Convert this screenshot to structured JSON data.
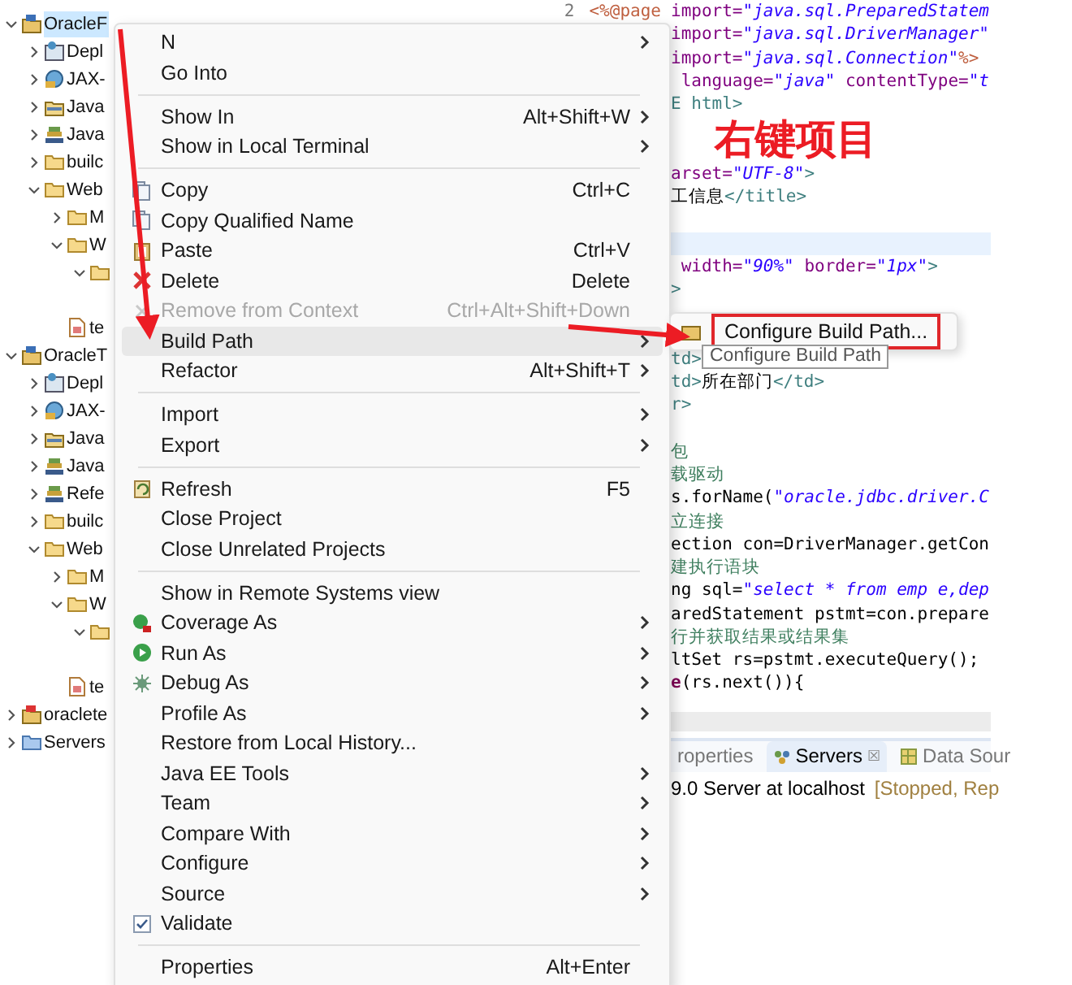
{
  "annotation": {
    "text": "右键项目"
  },
  "tree": [
    {
      "label": "OracleF",
      "kind": "project",
      "selected": true,
      "expanded": true,
      "children": [
        {
          "label": "Depl",
          "kind": "descriptor",
          "selected": false,
          "expanded": false
        },
        {
          "label": "JAX-",
          "kind": "service",
          "selected": false,
          "expanded": false
        },
        {
          "label": "Java",
          "kind": "library",
          "selected": false,
          "expanded": false
        },
        {
          "label": "Java",
          "kind": "script",
          "selected": false,
          "expanded": false
        },
        {
          "label": "builc",
          "kind": "folder",
          "selected": false,
          "expanded": false
        },
        {
          "label": "Web",
          "kind": "folder",
          "selected": false,
          "expanded": true,
          "children": [
            {
              "label": "M",
              "kind": "folder",
              "selected": false,
              "expanded": false
            },
            {
              "label": "W",
              "kind": "folder",
              "selected": false,
              "expanded": true,
              "children": [
                {
                  "kind": "folder",
                  "expanded": true
                }
              ]
            },
            {
              "label": "te",
              "kind": "file",
              "selected": false
            }
          ]
        }
      ]
    },
    {
      "label": "OracleT",
      "kind": "project",
      "selected": false,
      "expanded": true,
      "children": [
        {
          "label": "Depl",
          "kind": "descriptor",
          "selected": false,
          "expanded": false
        },
        {
          "label": "JAX-",
          "kind": "service",
          "selected": false,
          "expanded": false
        },
        {
          "label": "Java",
          "kind": "library",
          "selected": false,
          "expanded": false
        },
        {
          "label": "Java",
          "kind": "script",
          "selected": false,
          "expanded": false
        },
        {
          "label": "Refe",
          "kind": "script",
          "selected": false,
          "expanded": false
        },
        {
          "label": "builc",
          "kind": "folder",
          "selected": false,
          "expanded": false
        },
        {
          "label": "Web",
          "kind": "folder",
          "selected": false,
          "expanded": true,
          "children": [
            {
              "label": "M",
              "kind": "folder",
              "selected": false,
              "expanded": false
            },
            {
              "label": "W",
              "kind": "folder",
              "selected": false,
              "expanded": true,
              "children": [
                {
                  "kind": "folder",
                  "expanded": true
                }
              ]
            },
            {
              "label": "te",
              "kind": "file",
              "selected": false
            }
          ]
        }
      ]
    },
    {
      "label": "oraclete",
      "kind": "error-project",
      "selected": false,
      "expanded": false
    },
    {
      "label": "Servers",
      "kind": "servers",
      "selected": false,
      "expanded": false
    }
  ],
  "editor": {
    "lines": [
      {
        "line_number": "2",
        "prefix": "<%@page",
        "current": false,
        "tokens": [
          {
            "text": "import=",
            "kind": "attr"
          },
          {
            "text": "\"java.sql.PreparedStatem",
            "kind": "string"
          }
        ]
      },
      {
        "current": false,
        "tokens": [
          {
            "text": "import=",
            "kind": "attr"
          },
          {
            "text": "\"java.sql.DriverManager\"",
            "kind": "string"
          }
        ]
      },
      {
        "current": false,
        "tokens": [
          {
            "text": "import=",
            "kind": "attr"
          },
          {
            "text": "\"java.sql.Connection\"",
            "kind": "string"
          },
          {
            "text": "%>",
            "kind": "directive"
          }
        ]
      },
      {
        "current": false,
        "tokens": [
          {
            "text": " language=",
            "kind": "attr"
          },
          {
            "text": "\"java\"",
            "kind": "string"
          },
          {
            "text": " contentType=",
            "kind": "attr"
          },
          {
            "text": "\"t",
            "kind": "string"
          }
        ]
      },
      {
        "current": false,
        "tokens": [
          {
            "text": "E html>",
            "kind": "tag"
          }
        ]
      },
      {
        "current": false
      },
      {
        "current": false
      },
      {
        "current": false,
        "tokens": [
          {
            "text": "arset=",
            "kind": "attr"
          },
          {
            "text": "\"UTF-8\"",
            "kind": "string"
          },
          {
            "text": ">",
            "kind": "tag"
          }
        ]
      },
      {
        "current": false,
        "tokens": [
          {
            "text": "工信息",
            "kind": "plain"
          },
          {
            "text": "</title>",
            "kind": "tag"
          }
        ]
      },
      {
        "current": false
      },
      {
        "current": true
      },
      {
        "current": false,
        "tokens": [
          {
            "text": " width=",
            "kind": "attr"
          },
          {
            "text": "\"90%\"",
            "kind": "string"
          },
          {
            "text": " border=",
            "kind": "attr"
          },
          {
            "text": "\"1px\"",
            "kind": "string"
          },
          {
            "text": ">",
            "kind": "tag"
          }
        ]
      },
      {
        "current": false,
        "tokens": [
          {
            "text": ">",
            "kind": "tag"
          }
        ]
      },
      {
        "current": false
      },
      {
        "current": false
      },
      {
        "current": false,
        "tokens": [
          {
            "text": "td>",
            "kind": "tag"
          }
        ]
      },
      {
        "current": false,
        "tokens": [
          {
            "text": "td>",
            "kind": "tag"
          },
          {
            "text": "所在部门",
            "kind": "plain"
          },
          {
            "text": "</td>",
            "kind": "tag"
          }
        ]
      },
      {
        "current": false,
        "tokens": [
          {
            "text": "r>",
            "kind": "tag"
          }
        ]
      },
      {
        "current": false
      },
      {
        "current": false,
        "tokens": [
          {
            "text": "包",
            "kind": "comment"
          }
        ]
      },
      {
        "current": false,
        "tokens": [
          {
            "text": "载驱动",
            "kind": "comment"
          }
        ]
      },
      {
        "current": false,
        "tokens": [
          {
            "text": "s.forName(",
            "kind": "plain"
          },
          {
            "text": "\"oracle.jdbc.driver.C",
            "kind": "string"
          }
        ]
      },
      {
        "current": false,
        "tokens": [
          {
            "text": "立连接",
            "kind": "comment"
          }
        ]
      },
      {
        "current": false,
        "tokens": [
          {
            "text": "ection con=DriverManager.getCon",
            "kind": "plain"
          }
        ]
      },
      {
        "current": false,
        "tokens": [
          {
            "text": "建执行语块",
            "kind": "comment"
          }
        ]
      },
      {
        "current": false,
        "tokens": [
          {
            "text": "ng sql=",
            "kind": "plain"
          },
          {
            "text": "\"select * from emp e,dep",
            "kind": "string"
          }
        ]
      },
      {
        "current": false,
        "tokens": [
          {
            "text": "aredStatement pstmt=con.prepare",
            "kind": "plain"
          }
        ]
      },
      {
        "current": false,
        "tokens": [
          {
            "text": "行并获取结果或结果集",
            "kind": "comment"
          }
        ]
      },
      {
        "current": false,
        "tokens": [
          {
            "text": "ltSet rs=pstmt.executeQuery();",
            "kind": "plain"
          }
        ]
      },
      {
        "current": false,
        "tokens": [
          {
            "text": "e",
            "kind": "keyword"
          },
          {
            "text": "(rs.next()){",
            "kind": "plain"
          }
        ]
      }
    ]
  },
  "bottom_panel": {
    "tabs": [
      {
        "label": "roperties",
        "selected": false
      },
      {
        "label": "Servers",
        "selected": true,
        "close": "☒"
      },
      {
        "label": "Data Sour",
        "selected": false
      }
    ],
    "server_row": {
      "name": "9.0 Server at localhost",
      "status": "[Stopped, Rep"
    }
  },
  "context_menu": {
    "items": [
      {
        "kind": "item",
        "label": "N",
        "submenu": true,
        "selected": false,
        "disabled": false
      },
      {
        "kind": "item",
        "label": "Go Into",
        "selected": false,
        "disabled": false
      },
      {
        "kind": "separator"
      },
      {
        "kind": "item",
        "label": "Show In",
        "shortcut": "Alt+Shift+W",
        "submenu": true,
        "selected": false,
        "disabled": false
      },
      {
        "kind": "item",
        "label": "Show in Local Terminal",
        "submenu": true,
        "selected": false,
        "disabled": false
      },
      {
        "kind": "separator"
      },
      {
        "kind": "item",
        "label": "Copy",
        "shortcut": "Ctrl+C",
        "selected": false,
        "disabled": false
      },
      {
        "kind": "item",
        "label": "Copy Qualified Name",
        "selected": false,
        "disabled": false
      },
      {
        "kind": "item",
        "label": "Paste",
        "shortcut": "Ctrl+V",
        "selected": false,
        "disabled": false
      },
      {
        "kind": "item",
        "label": "Delete",
        "shortcut": "Delete",
        "selected": false,
        "disabled": false
      },
      {
        "kind": "item",
        "label": "Remove from Context",
        "shortcut": "Ctrl+Alt+Shift+Down",
        "selected": false,
        "disabled": true
      },
      {
        "kind": "item",
        "label": "Build Path",
        "submenu": true,
        "selected": true,
        "disabled": false
      },
      {
        "kind": "item",
        "label": "Refactor",
        "shortcut": "Alt+Shift+T",
        "submenu": true,
        "selected": false,
        "disabled": false
      },
      {
        "kind": "separator"
      },
      {
        "kind": "item",
        "label": "Import",
        "submenu": true,
        "selected": false,
        "disabled": false
      },
      {
        "kind": "item",
        "label": "Export",
        "submenu": true,
        "selected": false,
        "disabled": false
      },
      {
        "kind": "separator"
      },
      {
        "kind": "item",
        "label": "Refresh",
        "shortcut": "F5",
        "selected": false,
        "disabled": false
      },
      {
        "kind": "item",
        "label": "Close Project",
        "selected": false,
        "disabled": false
      },
      {
        "kind": "item",
        "label": "Close Unrelated Projects",
        "selected": false,
        "disabled": false
      },
      {
        "kind": "separator"
      },
      {
        "kind": "item",
        "label": "Show in Remote Systems view",
        "selected": false,
        "disabled": false
      },
      {
        "kind": "item",
        "label": "Coverage As",
        "submenu": true,
        "selected": false,
        "disabled": false
      },
      {
        "kind": "item",
        "label": "Run As",
        "submenu": true,
        "selected": false,
        "disabled": false
      },
      {
        "kind": "item",
        "label": "Debug As",
        "submenu": true,
        "selected": false,
        "disabled": false
      },
      {
        "kind": "item",
        "label": "Profile As",
        "submenu": true,
        "selected": false,
        "disabled": false
      },
      {
        "kind": "item",
        "label": "Restore from Local History...",
        "selected": false,
        "disabled": false
      },
      {
        "kind": "item",
        "label": "Java EE Tools",
        "submenu": true,
        "selected": false,
        "disabled": false
      },
      {
        "kind": "item",
        "label": "Team",
        "submenu": true,
        "selected": false,
        "disabled": false
      },
      {
        "kind": "item",
        "label": "Compare With",
        "submenu": true,
        "selected": false,
        "disabled": false
      },
      {
        "kind": "item",
        "label": "Configure",
        "submenu": true,
        "selected": false,
        "disabled": false
      },
      {
        "kind": "item",
        "label": "Source",
        "submenu": true,
        "selected": false,
        "disabled": false
      },
      {
        "kind": "item",
        "label": "Validate",
        "selected": false,
        "disabled": false,
        "checked": true
      },
      {
        "kind": "separator"
      },
      {
        "kind": "item",
        "label": "Properties",
        "shortcut": "Alt+Enter",
        "selected": false,
        "disabled": false
      }
    ]
  },
  "submenu": {
    "items": [
      {
        "label": "Configure Build Path...",
        "highlighted": true
      }
    ]
  },
  "tooltip": {
    "text": "Configure Build Path"
  }
}
